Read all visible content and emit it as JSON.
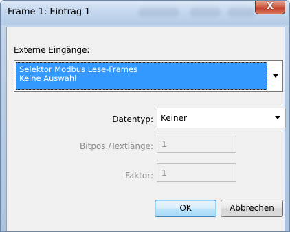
{
  "window": {
    "title": "Frame 1: Eintrag 1",
    "close_glyph": "X"
  },
  "form": {
    "external_inputs_label": "Externe Eingänge:",
    "external_inputs_selected_line1": "Selektor Modbus Lese-Frames",
    "external_inputs_selected_line2": "Keine Auswahl",
    "datatype_label": "Datentyp:",
    "datatype_value": "Keiner",
    "bitpos_label": "Bitpos./Textlänge:",
    "bitpos_value": "1",
    "factor_label": "Faktor:",
    "factor_value": "1"
  },
  "buttons": {
    "ok": "OK",
    "cancel": "Abbrechen"
  },
  "colors": {
    "selection": "#3399ff",
    "close_button": "#c8553d",
    "disabled_text": "#8a8a8a"
  },
  "icons": {
    "close": "close-icon",
    "dropdown": "chevron-down-icon"
  }
}
